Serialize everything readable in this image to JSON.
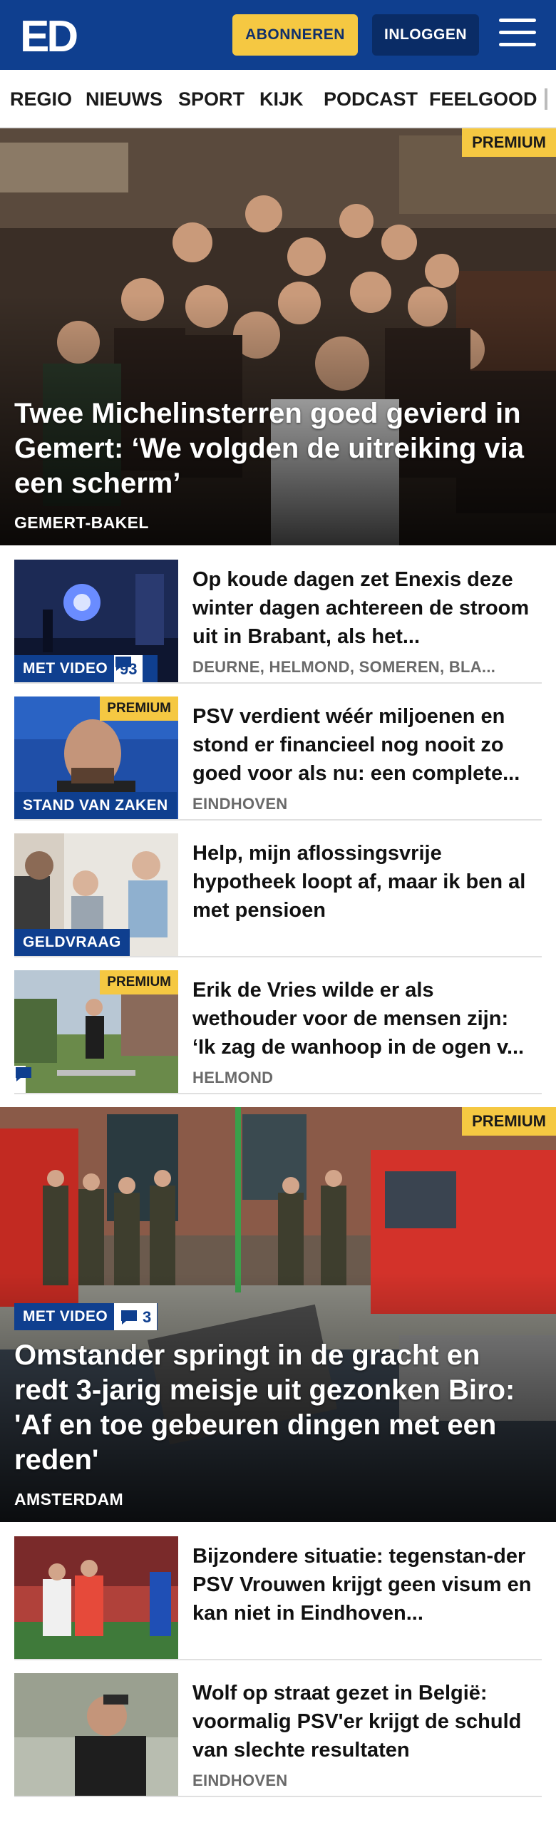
{
  "header": {
    "logo_text": "ED",
    "subscribe_label": "ABONNEREN",
    "login_label": "INLOGGEN",
    "menu_icon": "hamburger-icon"
  },
  "nav": {
    "items": [
      "REGIO",
      "NIEUWS",
      "SPORT",
      "KIJK",
      "PODCAST",
      "FEELGOOD"
    ]
  },
  "colors": {
    "brand_blue": "#0f3f8f",
    "accent_yellow": "#f5c842"
  },
  "hero1": {
    "premium_label": "PREMIUM",
    "title": "Twee Michelinsterren goed gevierd in Gemert: ‘We volgden de uitreiking via een scherm’",
    "location": "GEMERT-BAKEL"
  },
  "articles": [
    {
      "title": "Op koude dagen zet Enexis deze winter dagen achtereen de stroom uit in Brabant, als het...",
      "location": "DEURNE, HELMOND, SOMEREN, BLA...",
      "label": "MET VIDEO",
      "comments": "93"
    },
    {
      "title": "PSV verdient wéér miljoenen en stond er financieel nog nooit zo goed voor als nu: een complete...",
      "location": "EINDHOVEN",
      "label": "STAND VAN ZAKEN",
      "premium_label": "PREMIUM"
    },
    {
      "title": "Help, mijn aflossingsvrije hypotheek loopt af, maar ik ben al met pensioen",
      "label": "GELDVRAAG"
    },
    {
      "title": "Erik de Vries wilde er als wethouder voor de mensen zijn: ‘Ik zag de wanhoop in de ogen v...",
      "location": "HELMOND",
      "premium_label": "PREMIUM",
      "comment_icon": "comment-icon"
    }
  ],
  "hero2": {
    "premium_label": "PREMIUM",
    "label": "MET VIDEO",
    "comments": "3",
    "title": "Omstander springt in de gracht en redt 3-jarig meisje uit gezonken Biro: 'Af en toe gebeuren dingen met een reden'",
    "location": "AMSTERDAM"
  },
  "articles2": [
    {
      "title": "Bijzondere situatie: tegenstan-der PSV Vrouwen krijgt geen visum en kan niet in Eindhoven..."
    },
    {
      "title": "Wolf op straat gezet in België: voormalig PSV'er krijgt de schuld van slechte resultaten",
      "location": "EINDHOVEN"
    }
  ]
}
